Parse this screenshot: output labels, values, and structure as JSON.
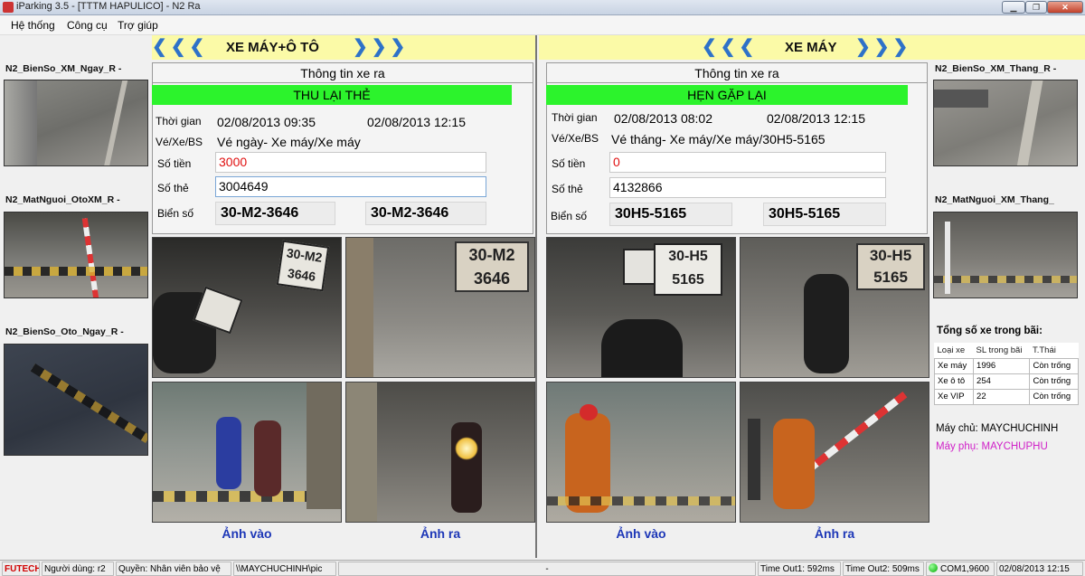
{
  "window": {
    "title": "iParking 3.5 - [TTTM HAPULICO] - N2 Ra",
    "minimize": "▁",
    "restore": "❐",
    "close": "✕"
  },
  "menu": {
    "items": [
      "Hệ thống",
      "Công cụ",
      "Trợ giúp"
    ]
  },
  "left": {
    "header": "XE MÁY+Ô TÔ",
    "nav_left": "❮❮❮",
    "nav_right": "❯❯❯",
    "cams": [
      "N2_BienSo_XM_Ngay_R -",
      "N2_MatNguoi_OtoXM_R -",
      "N2_BienSo_Oto_Ngay_R -"
    ],
    "box_title": "Thông tin xe ra",
    "banner": "THU LẠI THẺ",
    "labels": {
      "time": "Thời gian",
      "ticket": "Vé/Xe/BS",
      "amount": "Số tiền",
      "card": "Số thẻ",
      "plate": "Biển số"
    },
    "time_in": "02/08/2013 09:35",
    "time_out": "02/08/2013 12:15",
    "ticket": "Vé ngày- Xe máy/Xe máy",
    "amount": "3000",
    "card": "3004649",
    "plate_in": "30-M2-3646",
    "plate_out": "30-M2-3646",
    "plate_photo_line1": "30-M2",
    "plate_photo_line2": "3646",
    "cap_in": "Ảnh vào",
    "cap_out": "Ảnh ra"
  },
  "right": {
    "header": "XE MÁY",
    "nav_left": "❮❮❮",
    "nav_right": "❯❯❯",
    "cams": [
      "N2_BienSo_XM_Thang_R -",
      "N2_MatNguoi_XM_Thang_"
    ],
    "box_title": "Thông tin xe ra",
    "banner": "HẸN GẶP LẠI",
    "labels": {
      "time": "Thời gian",
      "ticket": "Vé/Xe/BS",
      "amount": "Số tiền",
      "card": "Số thẻ",
      "plate": "Biển số"
    },
    "time_in": "02/08/2013 08:02",
    "time_out": "02/08/2013 12:15",
    "ticket": "Vé tháng- Xe máy/Xe máy/30H5-5165",
    "amount": "0",
    "card": "4132866",
    "plate_in": "30H5-5165",
    "plate_out": "30H5-5165",
    "plate_photo_line1": "30-H5",
    "plate_photo_line2": "5165",
    "cap_in": "Ảnh vào",
    "cap_out": "Ảnh ra"
  },
  "stats": {
    "title": "Tổng số xe trong bãi:",
    "headers": [
      "Loại xe",
      "SL trong bãi",
      "T.Thái"
    ],
    "rows": [
      [
        "Xe máy",
        "1996",
        "Còn trống"
      ],
      [
        "Xe ô tô",
        "254",
        "Còn trống"
      ],
      [
        "Xe VIP",
        "22",
        "Còn trống"
      ]
    ],
    "server": "Máy chủ: MAYCHUCHINH",
    "backup": "Máy phụ: MAYCHUPHU"
  },
  "status": {
    "brand": "FUTECH",
    "user": "Người dùng: r2",
    "role": "Quyền: Nhân viên bảo vệ",
    "path": "\\\\MAYCHUCHINH\\pic",
    "dash": "-",
    "t1": "Time Out1: 592ms",
    "t2": "Time Out2: 509ms",
    "com": "COM1,9600",
    "datetime": "02/08/2013 12:15"
  },
  "colors": {
    "header_bg": "#fbfaa7",
    "nav": "#2e72c8",
    "banner": "#2cf32c",
    "amount": "#e01010",
    "caption": "#1d37b7",
    "backup": "#d020c8",
    "brand": "#d00000"
  }
}
